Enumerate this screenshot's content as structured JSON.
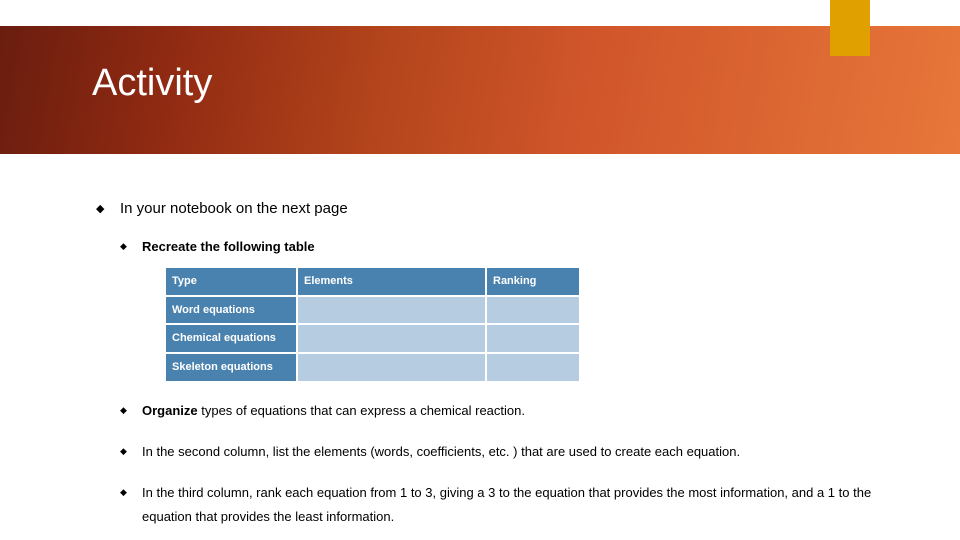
{
  "title": "Activity",
  "bullets": {
    "main": "In your notebook on the next page",
    "sub1": "Recreate the following table",
    "sub2_bold": "Organize",
    "sub2_rest": " types of equations that can express a chemical reaction.",
    "sub3": "In the second column, list the elements (words, coefficients, etc. ) that are used to create each equation.",
    "sub4": "In the third column, rank each equation from 1 to 3, giving a 3 to the equation that provides the most information, and a 1 to the equation that provides the least information."
  },
  "table": {
    "headers": {
      "c1": "Type",
      "c2": "Elements",
      "c3": "Ranking"
    },
    "rows": [
      "Word equations",
      "Chemical equations",
      "Skeleton equations"
    ]
  }
}
